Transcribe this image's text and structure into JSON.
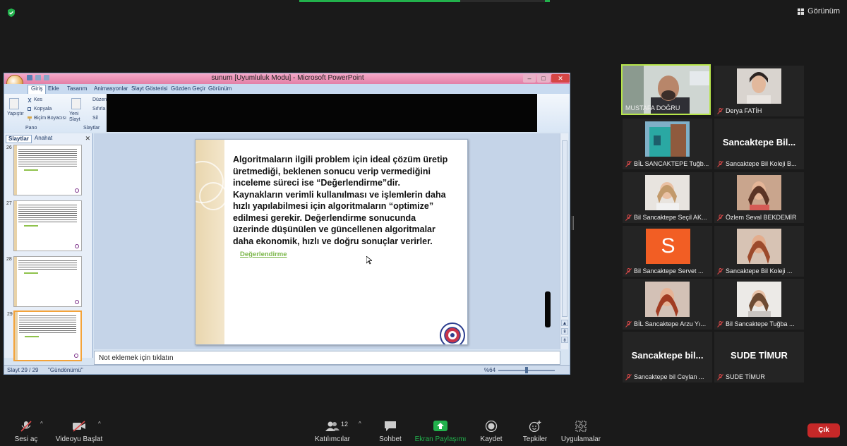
{
  "top": {
    "view_label": "Görünüm"
  },
  "ppt": {
    "title": "sunum [Uyumluluk Modu] - Microsoft PowerPoint",
    "tabs": [
      "Giriş",
      "Ekle",
      "Tasarım",
      "Animasyonlar",
      "Slayt Gösterisi",
      "Gözden Geçir",
      "Görünüm"
    ],
    "ribbon": {
      "paste": "Yapıştır",
      "cut": "Kes",
      "copy": "Kopyala",
      "format_painter": "Biçim Boyacısı",
      "clipboard_group": "Pano",
      "new_slide": "Yeni Slayt",
      "layout": "Düzen",
      "reset": "Sıfırla",
      "delete": "Sil",
      "slides_group": "Slaytlar"
    },
    "panel_tabs": {
      "slides": "Slaytlar",
      "outline": "Anahat"
    },
    "thumb_numbers": [
      "26",
      "27",
      "28",
      "29"
    ],
    "slide_text_parts": {
      "before": "Algoritmaların ilgili problem için ideal çözüm üretip üretmediği, beklenen sonucu verip vermediğini inceleme süreci ise ",
      "bold": "“Değerlendirme”",
      "after": "dir. Kaynakların verimli kullanılması ve işlemlerin daha hızlı yapılabilmesi için algoritmaların “optimize” edilmesi gerekir. Değerlendirme sonucunda üzerinde düşünülen ve güncellenen algoritmalar daha ekonomik, hızlı ve doğru sonuçlar verirler."
    },
    "slide_link": "Değerlendirme",
    "notes_placeholder": "Not eklemek için tıklatın",
    "status_slide": "Slayt 29 / 29",
    "status_theme": "\"Gündönümü\"",
    "zoom": "%64"
  },
  "participants": [
    {
      "name": "MUSTAFA DOĞRU",
      "muted": false,
      "type": "video"
    },
    {
      "name": "Derya FATİH",
      "muted": true,
      "type": "photo"
    },
    {
      "name": "BİL SANCAKTEPE Tuğb...",
      "muted": true,
      "type": "photo"
    },
    {
      "name": "Sancaktepe Bil Koleji B...",
      "muted": true,
      "type": "text",
      "display": "Sancaktepe  Bil..."
    },
    {
      "name": "Bil Sancaktepe Seçil AK...",
      "muted": true,
      "type": "photo"
    },
    {
      "name": "Özlem Seval BEKDEMİR",
      "muted": true,
      "type": "photo"
    },
    {
      "name": "Bil Sancaktepe Servet ...",
      "muted": true,
      "type": "letter",
      "display": "S"
    },
    {
      "name": "Sancaktepe Bil Koleji ...",
      "muted": true,
      "type": "photo"
    },
    {
      "name": "BİL Sancaktepe Arzu Yı...",
      "muted": true,
      "type": "photo"
    },
    {
      "name": "Bil Sancaktepe Tuğba ...",
      "muted": true,
      "type": "photo"
    },
    {
      "name": "Sancaktepe bil Ceylan ...",
      "muted": true,
      "type": "text",
      "display": "Sancaktepe  bil..."
    },
    {
      "name": "SUDE TİMUR",
      "muted": true,
      "type": "text",
      "display": "SUDE TİMUR"
    }
  ],
  "controls": {
    "audio": "Sesi aç",
    "video": "Videoyu Başlat",
    "participants": "Katılımcılar",
    "participants_count": "12",
    "chat": "Sohbet",
    "share": "Ekran Paylaşımı",
    "record": "Kaydet",
    "reactions": "Tepkiler",
    "apps": "Uygulamalar",
    "leave": "Çık"
  },
  "colors": {
    "active_speaker": "#b7e54a",
    "share_green": "#22b14c",
    "leave_red": "#c62828",
    "link_green": "#7ab648"
  }
}
